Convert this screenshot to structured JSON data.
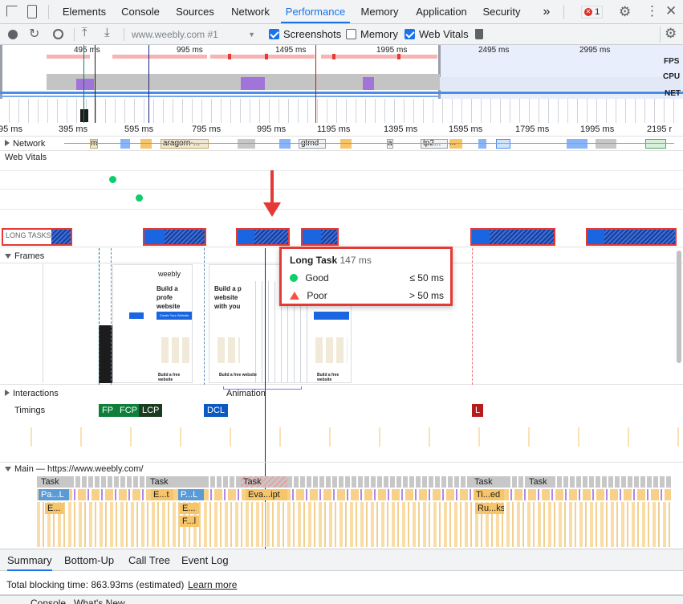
{
  "tabs": [
    "Elements",
    "Console",
    "Sources",
    "Network",
    "Performance",
    "Memory",
    "Application",
    "Security"
  ],
  "active_tab": "Performance",
  "more_tabs": "»",
  "error_count": "1",
  "toolbar": {
    "url": "www.weebly.com #1",
    "screenshots_label": "Screenshots",
    "memory_label": "Memory",
    "web_vitals_label": "Web Vitals"
  },
  "overview": {
    "time_labels": [
      "495 ms",
      "995 ms",
      "1495 ms",
      "1995 ms",
      "2495 ms",
      "2995 ms"
    ],
    "fps_label": "FPS",
    "cpu_label": "CPU",
    "net_label": "NET"
  },
  "ruler_labels": [
    "95 ms",
    "395 ms",
    "595 ms",
    "795 ms",
    "995 ms",
    "1195 ms",
    "1395 ms",
    "1595 ms",
    "1795 ms",
    "1995 ms",
    "2195 r"
  ],
  "tracks": {
    "network": "Network",
    "web_vitals": "Web Vitals",
    "long_tasks": "LONG TASKS",
    "frames": "Frames",
    "interactions": "Interactions",
    "timings": "Timings",
    "main": "Main — https://www.weebly.com/",
    "animation": "Animation"
  },
  "network_chips": [
    "m",
    "aragorn-...",
    "gtmd",
    "a",
    "tp2...",
    "..."
  ],
  "timings": [
    "FP",
    "FCP",
    "LCP",
    "DCL",
    "L"
  ],
  "tooltip": {
    "title": "Long Task",
    "duration": "147 ms",
    "good_label": "Good",
    "good_value": "≤ 50 ms",
    "poor_label": "Poor",
    "poor_value": "> 50 ms"
  },
  "main_tasks": [
    "Task",
    "Task",
    "Task",
    "Task",
    "Task"
  ],
  "main_subtasks": [
    "Pa...L",
    "E...t",
    "P...L",
    "Eva...ipt",
    "Ti...ed",
    "E...",
    "E...",
    "Ru...ks",
    "F...l"
  ],
  "screenshot_text": {
    "brand": "weebly",
    "headline": "Build a profe website that with your bu",
    "headline2": "Build a p website with you",
    "cta": "Create Your Website",
    "footer": "Build a free website"
  },
  "bottom_tabs": [
    "Summary",
    "Bottom-Up",
    "Call Tree",
    "Event Log"
  ],
  "active_bottom_tab": "Summary",
  "status": {
    "text": "Total blocking time: 863.93ms (estimated)",
    "link": "Learn more"
  },
  "footer_partial": "Console   What's New",
  "colors": {
    "accent": "#1a73e8",
    "long_task": "#1a66e0",
    "highlight": "#e53935",
    "good": "#0cce6b",
    "poor": "#ff4e42"
  }
}
